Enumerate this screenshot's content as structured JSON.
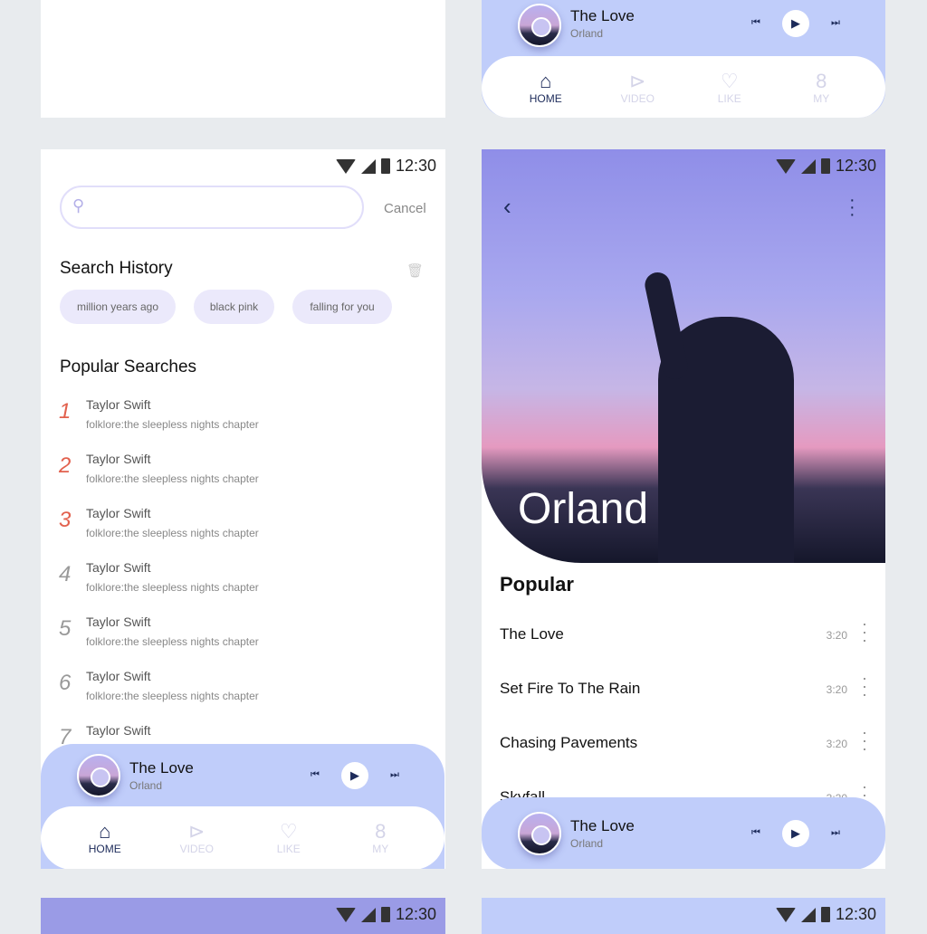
{
  "status": {
    "time": "12:30"
  },
  "player": {
    "title": "The Love",
    "artist": "Orland",
    "prev_icon": "skip-previous-icon",
    "play_icon": "play-icon",
    "next_icon": "skip-next-icon"
  },
  "nav": [
    {
      "label": "HOME",
      "icon": "home-icon",
      "active": true
    },
    {
      "label": "VIDEO",
      "icon": "video-icon"
    },
    {
      "label": "LIKE",
      "icon": "heart-icon"
    },
    {
      "label": "MY",
      "icon": "user-icon"
    }
  ],
  "search": {
    "placeholder": "",
    "cancel": "Cancel",
    "history_title": "Search History",
    "history": [
      "million years ago",
      "black pink",
      "falling for you"
    ],
    "popular_title": "Popular Searches",
    "popular": [
      {
        "rank": "1",
        "title": "Taylor Swift",
        "subtitle": "folklore:the sleepless nights chapter"
      },
      {
        "rank": "2",
        "title": "Taylor Swift",
        "subtitle": "folklore:the sleepless nights chapter"
      },
      {
        "rank": "3",
        "title": "Taylor Swift",
        "subtitle": "folklore:the sleepless nights chapter"
      },
      {
        "rank": "4",
        "title": "Taylor Swift",
        "subtitle": "folklore:the sleepless nights chapter"
      },
      {
        "rank": "5",
        "title": "Taylor Swift",
        "subtitle": "folklore:the sleepless nights chapter"
      },
      {
        "rank": "6",
        "title": "Taylor Swift",
        "subtitle": "folklore:the sleepless nights chapter"
      },
      {
        "rank": "7",
        "title": "Taylor Swift",
        "subtitle": ""
      }
    ]
  },
  "artist": {
    "name": "Orland",
    "popular_title": "Popular",
    "songs": [
      {
        "title": "The Love",
        "duration": "3:20"
      },
      {
        "title": "Set Fire To The Rain",
        "duration": "3:20"
      },
      {
        "title": "Chasing Pavements",
        "duration": "3:20"
      },
      {
        "title": "Skyfall",
        "duration": "3:20"
      }
    ]
  },
  "colors": {
    "accent": "#c0cdfa",
    "navy": "#1d2b5a",
    "hot_rank": "#e2614e",
    "chip": "#ebe9fb"
  }
}
